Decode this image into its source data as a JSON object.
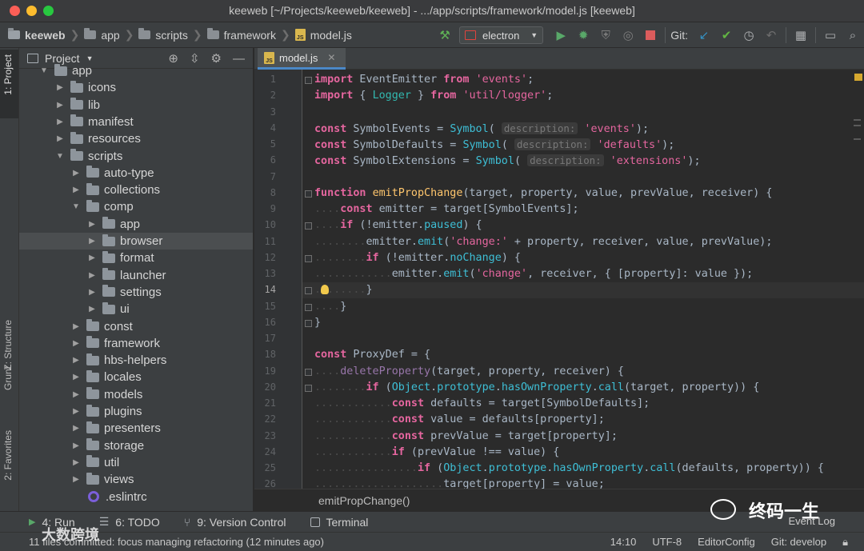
{
  "window": {
    "title": "keeweb [~/Projects/keeweb/keeweb] - .../app/scripts/framework/model.js [keeweb]"
  },
  "breadcrumbs": [
    "keeweb",
    "app",
    "scripts",
    "framework",
    "model.js"
  ],
  "toolbar": {
    "run_config": "electron",
    "git_label": "Git:"
  },
  "side_tabs": {
    "project": "1: Project",
    "structure": "Z: Structure",
    "grunt": "Grunt",
    "favorites": "2: Favorites"
  },
  "project_panel": {
    "title": "Project",
    "tree": [
      {
        "label": "app",
        "depth": 0,
        "expanded": true,
        "kind": "folder"
      },
      {
        "label": "icons",
        "depth": 1,
        "expanded": false,
        "kind": "folder"
      },
      {
        "label": "lib",
        "depth": 1,
        "expanded": false,
        "kind": "folder"
      },
      {
        "label": "manifest",
        "depth": 1,
        "expanded": false,
        "kind": "folder"
      },
      {
        "label": "resources",
        "depth": 1,
        "expanded": false,
        "kind": "folder"
      },
      {
        "label": "scripts",
        "depth": 1,
        "expanded": true,
        "kind": "folder"
      },
      {
        "label": "auto-type",
        "depth": 2,
        "expanded": false,
        "kind": "folder"
      },
      {
        "label": "collections",
        "depth": 2,
        "expanded": false,
        "kind": "folder"
      },
      {
        "label": "comp",
        "depth": 2,
        "expanded": true,
        "kind": "folder"
      },
      {
        "label": "app",
        "depth": 3,
        "expanded": false,
        "kind": "folder"
      },
      {
        "label": "browser",
        "depth": 3,
        "expanded": false,
        "kind": "folder",
        "selected": true
      },
      {
        "label": "format",
        "depth": 3,
        "expanded": false,
        "kind": "folder"
      },
      {
        "label": "launcher",
        "depth": 3,
        "expanded": false,
        "kind": "folder"
      },
      {
        "label": "settings",
        "depth": 3,
        "expanded": false,
        "kind": "folder"
      },
      {
        "label": "ui",
        "depth": 3,
        "expanded": false,
        "kind": "folder"
      },
      {
        "label": "const",
        "depth": 2,
        "expanded": false,
        "kind": "folder"
      },
      {
        "label": "framework",
        "depth": 2,
        "expanded": false,
        "kind": "folder"
      },
      {
        "label": "hbs-helpers",
        "depth": 2,
        "expanded": false,
        "kind": "folder"
      },
      {
        "label": "locales",
        "depth": 2,
        "expanded": false,
        "kind": "folder"
      },
      {
        "label": "models",
        "depth": 2,
        "expanded": false,
        "kind": "folder"
      },
      {
        "label": "plugins",
        "depth": 2,
        "expanded": false,
        "kind": "folder"
      },
      {
        "label": "presenters",
        "depth": 2,
        "expanded": false,
        "kind": "folder"
      },
      {
        "label": "storage",
        "depth": 2,
        "expanded": false,
        "kind": "folder"
      },
      {
        "label": "util",
        "depth": 2,
        "expanded": false,
        "kind": "folder"
      },
      {
        "label": "views",
        "depth": 2,
        "expanded": false,
        "kind": "folder"
      },
      {
        "label": ".eslintrc",
        "depth": 2,
        "expanded": false,
        "kind": "eslint"
      }
    ]
  },
  "editor": {
    "tab": "model.js",
    "current_line": 14,
    "structure_crumb": "emitPropChange()",
    "line_numbers": [
      "1",
      "2",
      "3",
      "4",
      "5",
      "6",
      "7",
      "8",
      "9",
      "10",
      "11",
      "12",
      "13",
      "14",
      "15",
      "16",
      "17",
      "18",
      "19",
      "20",
      "21",
      "22",
      "23",
      "24",
      "25",
      "26"
    ],
    "lines": [
      [
        [
          "kwp",
          "import"
        ],
        [
          "p",
          " EventEmitter "
        ],
        [
          "kwp",
          "from"
        ],
        [
          "p",
          " "
        ],
        [
          "str",
          "'events'"
        ],
        [
          "p",
          ";"
        ]
      ],
      [
        [
          "kwp",
          "import"
        ],
        [
          "p",
          " { "
        ],
        [
          "teal",
          "Logger"
        ],
        [
          "p",
          " } "
        ],
        [
          "kwp",
          "from"
        ],
        [
          "p",
          " "
        ],
        [
          "str",
          "'util/logger'"
        ],
        [
          "p",
          ";"
        ]
      ],
      [],
      [
        [
          "kwp",
          "const"
        ],
        [
          "p",
          " SymbolEvents = "
        ],
        [
          "cy",
          "Symbol"
        ],
        [
          "p",
          "( "
        ],
        [
          "hint",
          "description:"
        ],
        [
          "p",
          " "
        ],
        [
          "str",
          "'events'"
        ],
        [
          "p",
          ");"
        ]
      ],
      [
        [
          "kwp",
          "const"
        ],
        [
          "p",
          " SymbolDefaults = "
        ],
        [
          "cy",
          "Symbol"
        ],
        [
          "p",
          "( "
        ],
        [
          "hint",
          "description:"
        ],
        [
          "p",
          " "
        ],
        [
          "str",
          "'defaults'"
        ],
        [
          "p",
          ");"
        ]
      ],
      [
        [
          "kwp",
          "const"
        ],
        [
          "p",
          " SymbolExtensions = "
        ],
        [
          "cy",
          "Symbol"
        ],
        [
          "p",
          "( "
        ],
        [
          "hint",
          "description:"
        ],
        [
          "p",
          " "
        ],
        [
          "str",
          "'extensions'"
        ],
        [
          "p",
          ");"
        ]
      ],
      [],
      [
        [
          "kwp",
          "function"
        ],
        [
          "p",
          " "
        ],
        [
          "fn",
          "emitPropChange"
        ],
        [
          "p",
          "(target, property, value, prevValue, receiver) {"
        ]
      ],
      [
        [
          "dots",
          "...."
        ],
        [
          "kwp",
          "const"
        ],
        [
          "p",
          " emitter = target[SymbolEvents];"
        ]
      ],
      [
        [
          "dots",
          "...."
        ],
        [
          "kwp",
          "if"
        ],
        [
          "p",
          " (!emitter."
        ],
        [
          "cy",
          "paused"
        ],
        [
          "p",
          ") {"
        ]
      ],
      [
        [
          "dots",
          "........"
        ],
        [
          "p",
          "emitter."
        ],
        [
          "cy",
          "emit"
        ],
        [
          "p",
          "("
        ],
        [
          "str",
          "'change:'"
        ],
        [
          "p",
          " + property, receiver, value, prevValue);"
        ]
      ],
      [
        [
          "dots",
          "........"
        ],
        [
          "kwp",
          "if"
        ],
        [
          "p",
          " (!emitter."
        ],
        [
          "cy",
          "noChange"
        ],
        [
          "p",
          ") {"
        ]
      ],
      [
        [
          "dots",
          "............"
        ],
        [
          "p",
          "emitter."
        ],
        [
          "cy",
          "emit"
        ],
        [
          "p",
          "("
        ],
        [
          "str",
          "'change'"
        ],
        [
          "p",
          ", receiver, { [property]: value });"
        ]
      ],
      [
        [
          "dots",
          "........"
        ],
        [
          "p",
          "}"
        ]
      ],
      [
        [
          "dots",
          "...."
        ],
        [
          "p",
          "}"
        ]
      ],
      [
        [
          "p",
          "}"
        ]
      ],
      [],
      [
        [
          "kwp",
          "const"
        ],
        [
          "p",
          " ProxyDef = {"
        ]
      ],
      [
        [
          "dots",
          "...."
        ],
        [
          "pur",
          "deleteProperty"
        ],
        [
          "p",
          "(target, property, receiver) {"
        ]
      ],
      [
        [
          "dots",
          "........"
        ],
        [
          "kwp",
          "if"
        ],
        [
          "p",
          " ("
        ],
        [
          "cy",
          "Object"
        ],
        [
          "p",
          "."
        ],
        [
          "cy",
          "prototype"
        ],
        [
          "p",
          "."
        ],
        [
          "cy",
          "hasOwnProperty"
        ],
        [
          "p",
          "."
        ],
        [
          "cy",
          "call"
        ],
        [
          "p",
          "(target, property)) {"
        ]
      ],
      [
        [
          "dots",
          "............"
        ],
        [
          "kwp",
          "const"
        ],
        [
          "p",
          " defaults = target[SymbolDefaults];"
        ]
      ],
      [
        [
          "dots",
          "............"
        ],
        [
          "kwp",
          "const"
        ],
        [
          "p",
          " value = defaults[property];"
        ]
      ],
      [
        [
          "dots",
          "............"
        ],
        [
          "kwp",
          "const"
        ],
        [
          "p",
          " prevValue = target[property];"
        ]
      ],
      [
        [
          "dots",
          "............"
        ],
        [
          "kwp",
          "if"
        ],
        [
          "p",
          " (prevValue !== value) {"
        ]
      ],
      [
        [
          "dots",
          "................"
        ],
        [
          "kwp",
          "if"
        ],
        [
          "p",
          " ("
        ],
        [
          "cy",
          "Object"
        ],
        [
          "p",
          "."
        ],
        [
          "cy",
          "prototype"
        ],
        [
          "p",
          "."
        ],
        [
          "cy",
          "hasOwnProperty"
        ],
        [
          "p",
          "."
        ],
        [
          "cy",
          "call"
        ],
        [
          "p",
          "(defaults, property)) {"
        ]
      ],
      [
        [
          "dots",
          "...................."
        ],
        [
          "p",
          "target[property] = value;"
        ]
      ]
    ]
  },
  "bottom_tabs": [
    {
      "label": "4: Run"
    },
    {
      "label": "6: TODO"
    },
    {
      "label": "9: Version Control"
    },
    {
      "label": "Terminal"
    }
  ],
  "event_log": "Event Log",
  "status": {
    "message": "11 files committed: focus managing refactoring (12 minutes ago)",
    "position": "14:10",
    "encoding": "UTF-8",
    "editorconfig": "EditorConfig",
    "git_branch": "Git: develop"
  },
  "watermarks": {
    "left": "大数跨境",
    "right": "终码一生"
  }
}
